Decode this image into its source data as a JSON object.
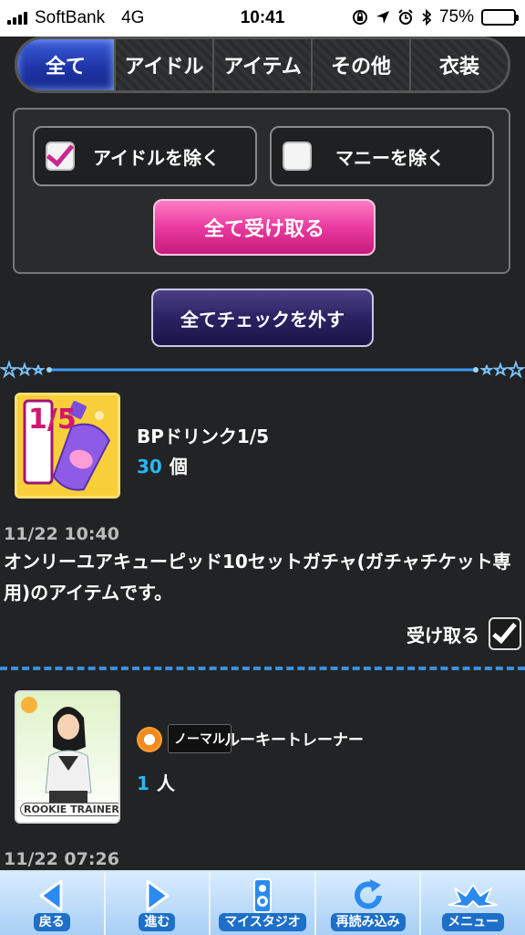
{
  "status_bar": {
    "carrier": "SoftBank",
    "network": "4G",
    "time": "10:41",
    "battery": "75%",
    "battery_level": 0.75,
    "icons": [
      "lock-rotation-icon",
      "location-icon",
      "alarm-icon",
      "bluetooth-icon",
      "battery-icon"
    ]
  },
  "tabs": [
    {
      "label": "全て",
      "active": true
    },
    {
      "label": "アイドル",
      "active": false
    },
    {
      "label": "アイテム",
      "active": false
    },
    {
      "label": "その他",
      "active": false
    },
    {
      "label": "衣装",
      "active": false
    }
  ],
  "filters": {
    "exclude_idol": {
      "label": "アイドルを除く",
      "checked": true
    },
    "exclude_money": {
      "label": "マニーを除く",
      "checked": false
    },
    "receive_all_label": "全て受け取る",
    "uncheck_all_label": "全てチェックを外す"
  },
  "items": [
    {
      "icon_text": "1/5",
      "name": "BPドリンク1/5",
      "quantity": "30",
      "unit": "個",
      "date": "11/22 10:40",
      "description": "オンリーユアキューピッド10セットガチャ(ガチャチケット専用)のアイテムです。",
      "receive_label": "受け取る",
      "checked": true
    },
    {
      "card_text": "ROOKIE TRAINER",
      "rarity": "ノーマル",
      "name": "ルーキートレーナー",
      "quantity": "1",
      "unit": "人",
      "date": "11/22 07:26"
    }
  ],
  "bottom_nav": [
    {
      "label": "戻る",
      "icon": "back-arrow-icon"
    },
    {
      "label": "進む",
      "icon": "forward-arrow-icon"
    },
    {
      "label": "マイスタジオ",
      "icon": "studio-speaker-icon"
    },
    {
      "label": "再読み込み",
      "icon": "reload-icon"
    },
    {
      "label": "メニュー",
      "icon": "menu-wings-icon"
    }
  ],
  "colors": {
    "accent_blue": "#29b6f6",
    "pink_button": "#ea3a9f",
    "navy_button": "#2a2262",
    "tab_active": "#1e35a8"
  }
}
